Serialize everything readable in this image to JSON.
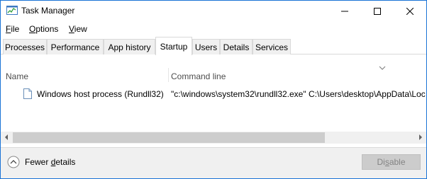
{
  "window": {
    "title": "Task Manager"
  },
  "menu": [
    {
      "label": "File",
      "underline": "F",
      "rest": "ile"
    },
    {
      "label": "Options",
      "underline": "O",
      "rest": "ptions"
    },
    {
      "label": "View",
      "underline": "V",
      "rest": "iew"
    }
  ],
  "tabs": [
    {
      "label": "Processes"
    },
    {
      "label": "Performance"
    },
    {
      "label": "App history"
    },
    {
      "label": "Startup",
      "active": true
    },
    {
      "label": "Users"
    },
    {
      "label": "Details"
    },
    {
      "label": "Services"
    }
  ],
  "table": {
    "columns": [
      "Name",
      "Command line"
    ],
    "rows": [
      {
        "name": "Windows host process (Rundll32)",
        "command": "\"c:\\windows\\system32\\rundll32.exe\" C:\\Users\\desktop\\AppData\\Loc"
      }
    ]
  },
  "footer": {
    "fewer_details": {
      "label": "Fewer details",
      "before": "Fewer ",
      "underline": "d",
      "after": "etails"
    },
    "disable": {
      "label": "Disable",
      "before": "Di",
      "underline": "s",
      "after": "able",
      "enabled": false
    }
  },
  "colors": {
    "border": "#1a73d6",
    "footer_bg": "#f0f0f0",
    "disabled_text": "#838383"
  },
  "icons": {
    "app": "task-manager-icon",
    "row": "file-icon",
    "footer": "chevron-up-circle-icon"
  }
}
